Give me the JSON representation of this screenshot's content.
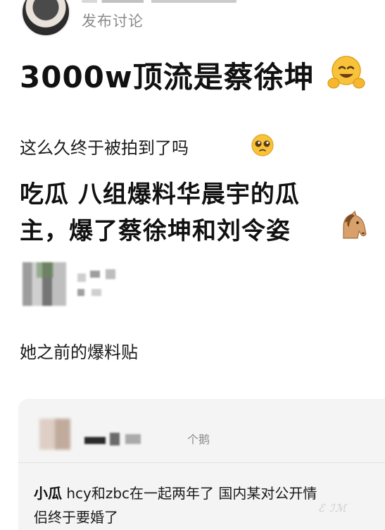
{
  "post": {
    "author_name": "",
    "post_type": "发布讨论",
    "title": "3000w顶流是蔡徐坤",
    "line1": "这么久终于被拍到了吗",
    "body_line1": "吃瓜 八组爆料华晨宇的瓜",
    "body_line2": "主，爆了蔡徐坤和刘令姿",
    "previous_post_label": "她之前的爆料贴"
  },
  "quote": {
    "group_suffix": "个鹅",
    "label": "小瓜",
    "text_line1": "hcy和zbc在一起两年了 国内某对公开情",
    "text_line2": "侣终于要婚了"
  },
  "icons": {
    "title_emoji": "hugging-face-icon",
    "line1_emoji": "pleading-face-icon",
    "body_emoji": "horse-icon"
  },
  "colors": {
    "text": "#111111",
    "secondary": "#8a8a8a",
    "card_bg": "#f4f4f4"
  }
}
